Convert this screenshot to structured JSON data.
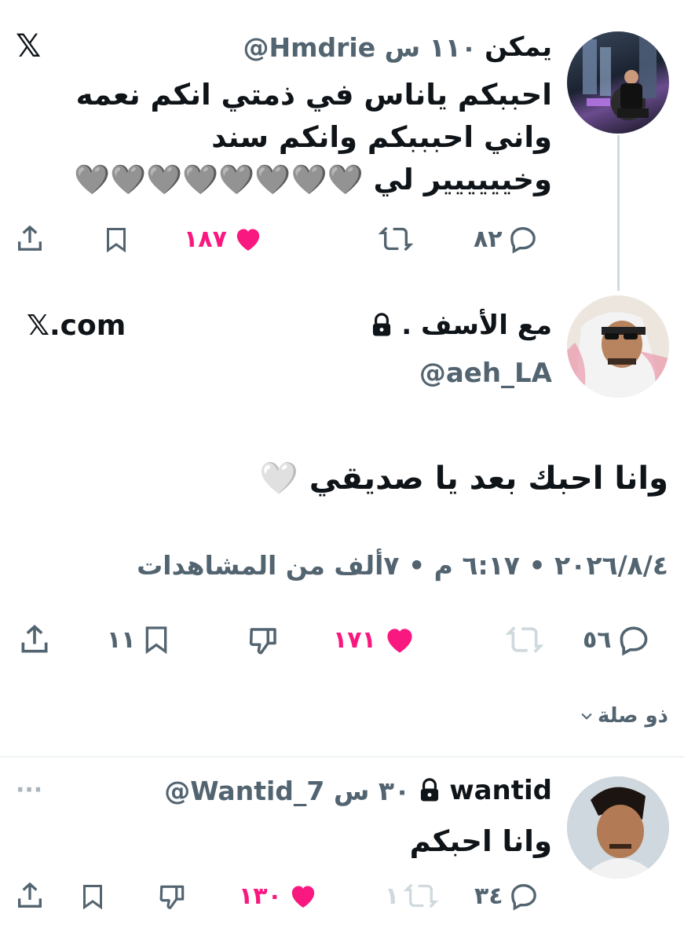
{
  "colors": {
    "text": "#0f1419",
    "muted": "#536471",
    "like": "#f91880",
    "divider": "#eff3f4"
  },
  "parent_tweet": {
    "name": "يمكن",
    "handle_time": "@Hmdrie ١١٠ س",
    "text_lines": [
      "احببكم ياناس في ذمتي انكم نعمه",
      "واني احبببكم وانكم سند",
      "وخيييييير لي 🩶🩶🩶🩶🩶🩶🩶🩶"
    ],
    "logo": "𝕏",
    "actions": {
      "replies": "٨٢",
      "likes": "١٨٧"
    }
  },
  "main_tweet": {
    "name": "مع الأسف .",
    "handle": "@aeh_LA",
    "site_label": "𝕏.com",
    "text": "وانا احبك بعد يا صديقي 🤍",
    "meta": "٢٠٢٦/٨/٤ • ٦:١٧ م • ٧ألف من المشاهدات",
    "actions": {
      "replies": "٥٦",
      "likes": "١٧١",
      "bookmarks": "١١"
    }
  },
  "replies_filter": {
    "label": "ذو صلة"
  },
  "reply_tweet": {
    "name": "wantid",
    "handle_time": "@Wantid_7 ٣٠ س",
    "more": "···",
    "text": "وانا احبكم",
    "actions": {
      "replies": "٣٤",
      "retweets": "١",
      "likes": "١٣٠"
    }
  }
}
